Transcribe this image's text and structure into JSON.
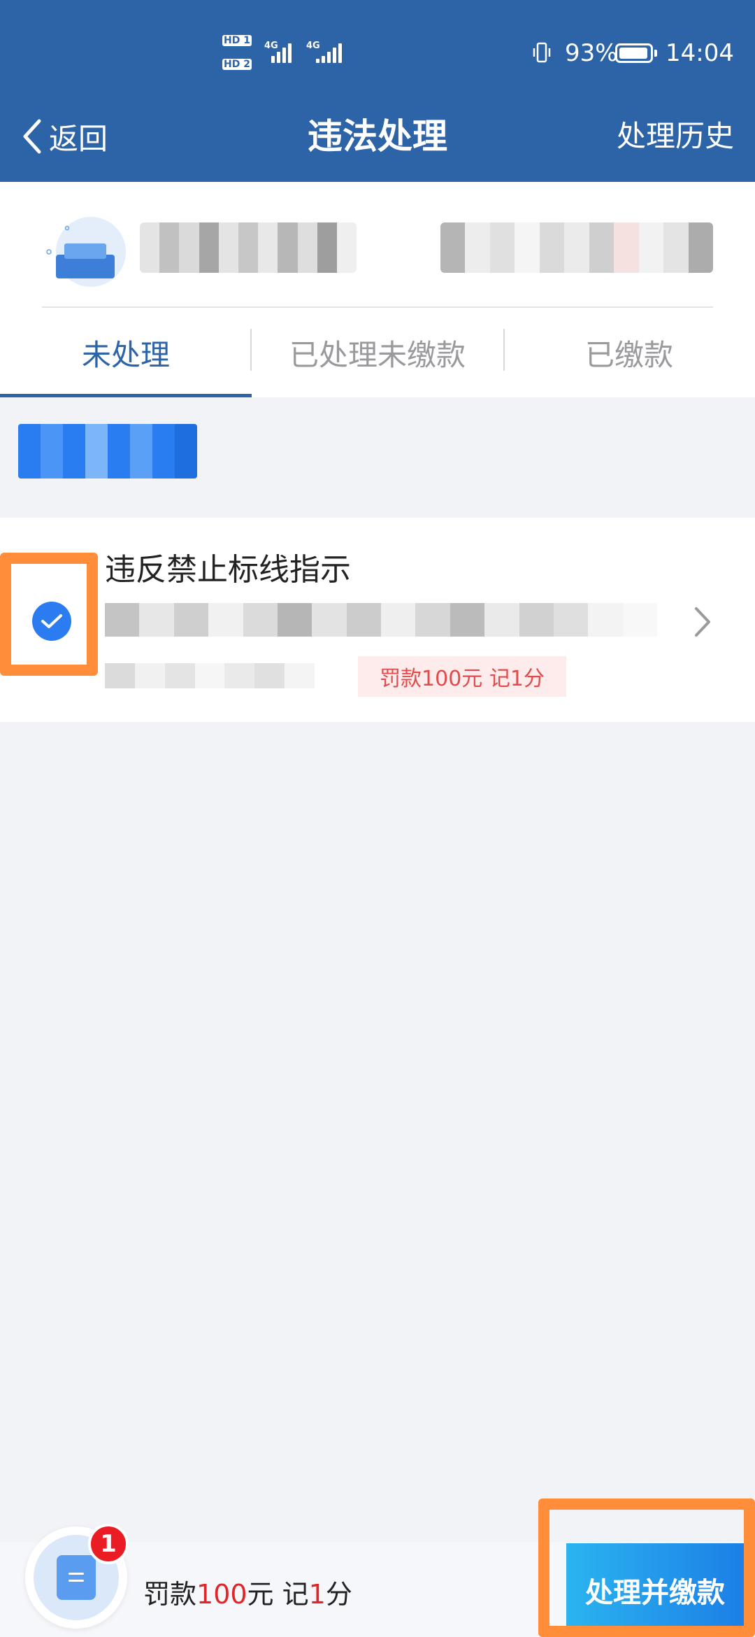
{
  "status_bar": {
    "hd1": "HD 1",
    "hd2": "HD 2",
    "network1": "4G",
    "network2": "4G",
    "battery_percent": "93%",
    "time": "14:04"
  },
  "nav": {
    "back_label": "返回",
    "title": "违法处理",
    "history_label": "处理历史"
  },
  "tabs": [
    {
      "label": "未处理",
      "active": true
    },
    {
      "label": "已处理未缴款",
      "active": false
    },
    {
      "label": "已缴款",
      "active": false
    }
  ],
  "violation": {
    "title": "违反禁止标线指示",
    "penalty": "罚款100元 记1分",
    "selected": true
  },
  "bottom_bar": {
    "count": "1",
    "summary_prefix": "罚款",
    "fine_amount": "100",
    "summary_mid": "元 记",
    "points": "1",
    "summary_suffix": "分",
    "pay_button_label": "处理并缴款"
  },
  "colors": {
    "primary": "#2c64a7",
    "checkbox": "#2a7cf0",
    "badge_red": "#ea1c24",
    "penalty_text": "#e24b4b",
    "highlight": "#ff8d3a",
    "button_gradient_start": "#2bb4f0",
    "button_gradient_end": "#1c7fe6"
  },
  "icons": {
    "back": "chevron-left-icon",
    "vibrate": "vibrate-icon",
    "battery": "battery-icon",
    "check": "check-icon",
    "chevron": "chevron-right-icon",
    "summary": "document-icon"
  }
}
